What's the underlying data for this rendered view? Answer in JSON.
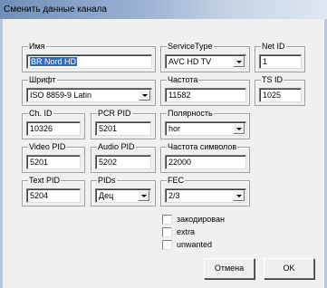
{
  "window": {
    "title": "Сменить данные канала"
  },
  "fields": {
    "name": {
      "label": "Имя",
      "value": "BR Nord HD"
    },
    "service_type": {
      "label": "ServiceType",
      "value": "AVC HD TV"
    },
    "net_id": {
      "label": "Net ID",
      "value": "1"
    },
    "font": {
      "label": "Шрифт",
      "value": "ISO 8859-9 Latin"
    },
    "frequency": {
      "label": "Частота",
      "value": "11582"
    },
    "ts_id": {
      "label": "TS ID",
      "value": "1025"
    },
    "ch_id": {
      "label": "Ch. ID",
      "value": "10326"
    },
    "pcr_pid": {
      "label": "PCR PID",
      "value": "5201"
    },
    "polarity": {
      "label": "Полярность",
      "value": "hor"
    },
    "video_pid": {
      "label": "Video PID",
      "value": "5201"
    },
    "audio_pid": {
      "label": "Audio PID",
      "value": "5202"
    },
    "symbol_rate": {
      "label": "Частота символов",
      "value": "22000"
    },
    "text_pid": {
      "label": "Text PID",
      "value": "5204"
    },
    "pids": {
      "label": "PIDs",
      "value": "Дец"
    },
    "fec": {
      "label": "FEC",
      "value": "2/3"
    }
  },
  "checkboxes": [
    {
      "label": "закодирован",
      "checked": false
    },
    {
      "label": "extra",
      "checked": false
    },
    {
      "label": "unwanted",
      "checked": false
    }
  ],
  "buttons": {
    "cancel": "Отмена",
    "ok": "OK"
  }
}
